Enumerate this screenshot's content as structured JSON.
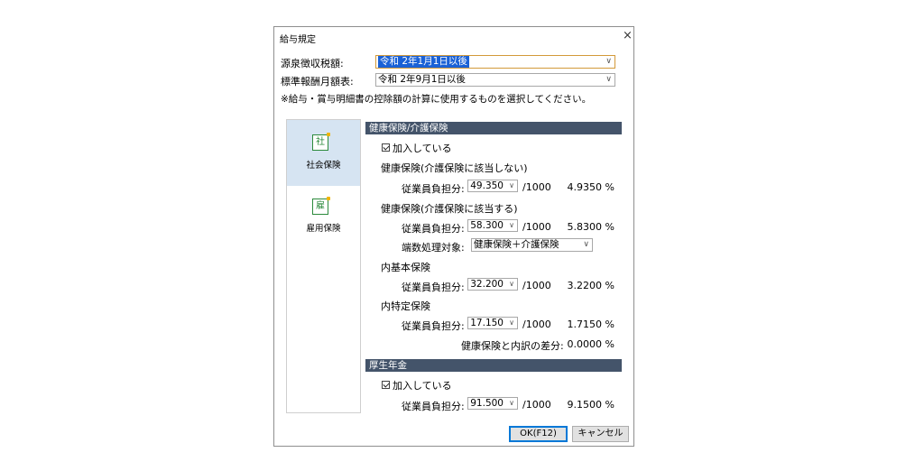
{
  "dialog": {
    "title": "給与規定",
    "close_glyph": "×"
  },
  "top": {
    "withholding_label": "源泉徴収税額:",
    "withholding_value": "令和 2年1月1日以後",
    "standard_label": "標準報酬月額表:",
    "standard_value": "令和 2年9月1日以後",
    "note": "※給与・賞与明細書の控除額の計算に使用するものを選択してください。"
  },
  "sidebar": {
    "items": [
      {
        "icon": "社",
        "icon_name": "shakai-icon",
        "label": "社会保険",
        "active": true
      },
      {
        "icon": "雇",
        "icon_name": "koyou-icon",
        "label": "雇用保険",
        "active": false
      }
    ]
  },
  "health": {
    "header": "健康保険/介護保険",
    "enrolled_label": "加入している",
    "no_care_label": "健康保険(介護保険に該当しない)",
    "no_care": {
      "label": "従業員負担分:",
      "value": "49.350",
      "unit": "/1000",
      "percent": "4.9350 %"
    },
    "care_label": "健康保険(介護保険に該当する)",
    "care": {
      "label": "従業員負担分:",
      "value": "58.300",
      "unit": "/1000",
      "percent": "5.8300 %"
    },
    "rounding_label": "端数処理対象:",
    "rounding_value": "健康保険＋介護保険",
    "basic_label": "内基本保険",
    "basic": {
      "label": "従業員負担分:",
      "value": "32.200",
      "unit": "/1000",
      "percent": "3.2200 %"
    },
    "specific_label": "内特定保険",
    "specific": {
      "label": "従業員負担分:",
      "value": "17.150",
      "unit": "/1000",
      "percent": "1.7150 %"
    },
    "diff_label": "健康保険と内訳の差分:",
    "diff_value": "0.0000 %"
  },
  "pension": {
    "header": "厚生年金",
    "enrolled_label": "加入している",
    "row": {
      "label": "従業員負担分:",
      "value": "91.500",
      "unit": "/1000",
      "percent": "9.1500 %"
    }
  },
  "buttons": {
    "ok": "OK(F12)",
    "cancel": "キャンセル"
  }
}
